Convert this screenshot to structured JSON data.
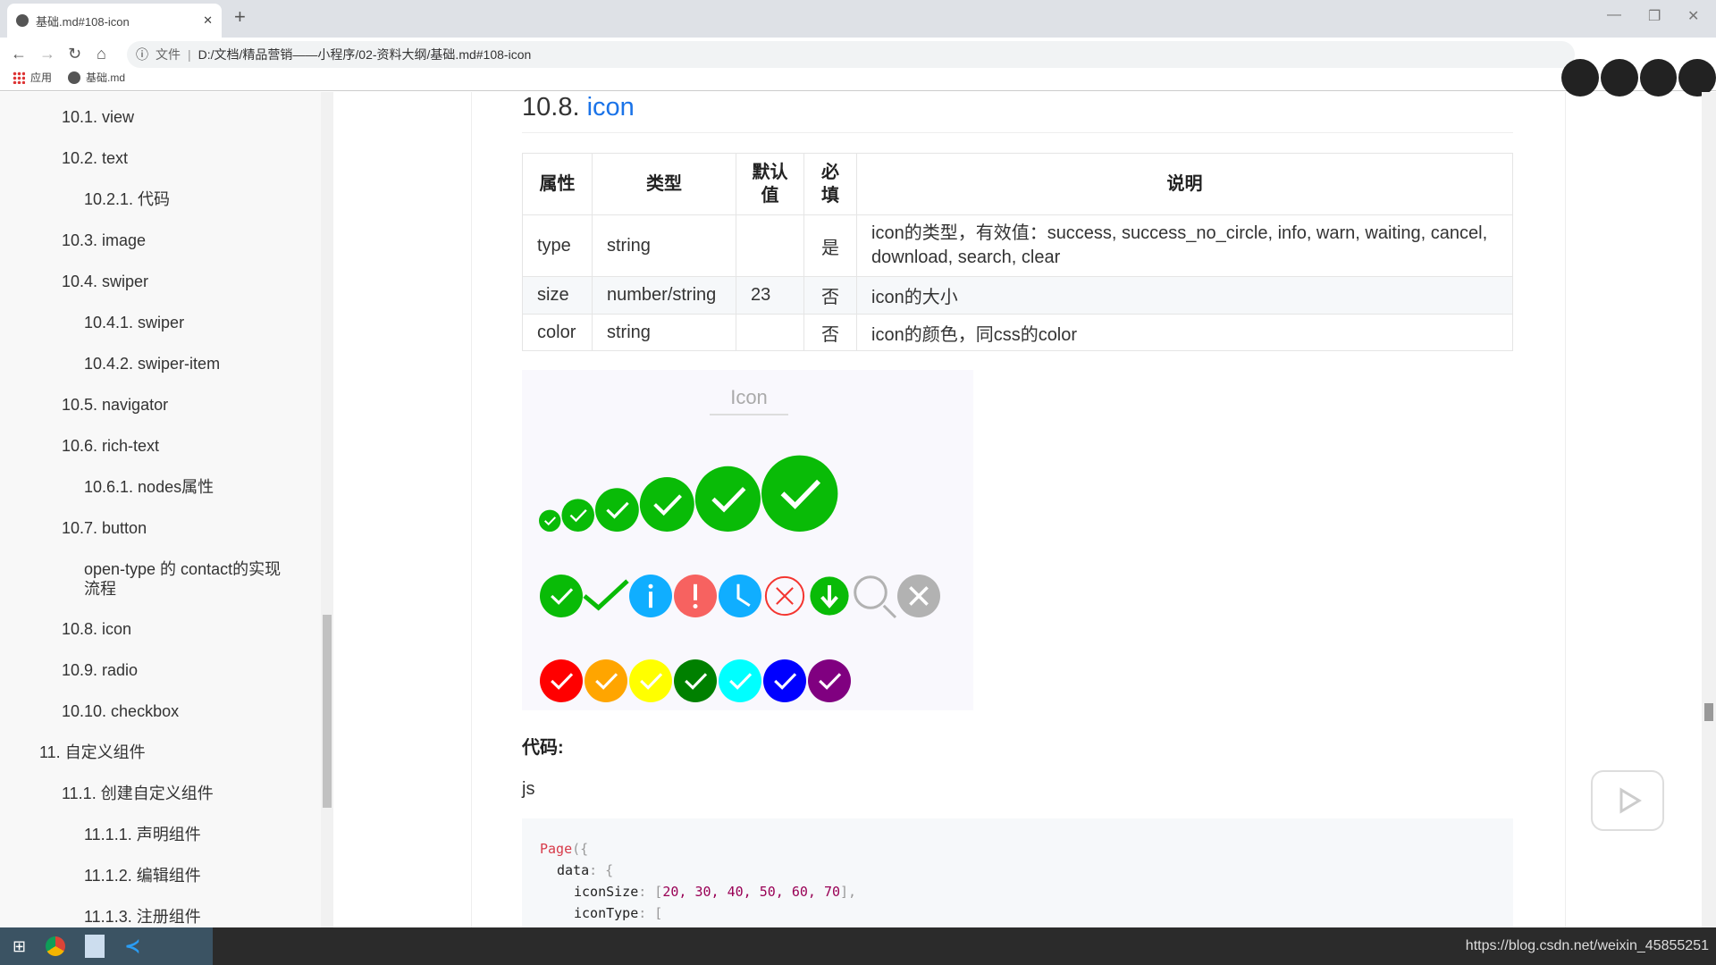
{
  "browser": {
    "tab_title": "基础.md#108-icon",
    "url_label": "文件",
    "url": "D:/文档/精品营销——小程序/02-资料大纲/基础.md#108-icon",
    "bookmarks": [
      {
        "label": "应用"
      },
      {
        "label": "基础.md"
      }
    ]
  },
  "sidebar": {
    "items": [
      {
        "label": "10.1. view",
        "level": 2
      },
      {
        "label": "10.2. text",
        "level": 2
      },
      {
        "label": "10.2.1. 代码",
        "level": 3
      },
      {
        "label": "10.3. image",
        "level": 2
      },
      {
        "label": "10.4. swiper",
        "level": 2
      },
      {
        "label": "10.4.1. swiper",
        "level": 3
      },
      {
        "label": "10.4.2. swiper-item",
        "level": 3
      },
      {
        "label": "10.5. navigator",
        "level": 2
      },
      {
        "label": "10.6. rich-text",
        "level": 2
      },
      {
        "label": "10.6.1. nodes属性",
        "level": 3
      },
      {
        "label": "10.7. button",
        "level": 2
      },
      {
        "label": "open-type 的 contact的实现流程",
        "level": 3
      },
      {
        "label": "10.8. icon",
        "level": 2
      },
      {
        "label": "10.9. radio",
        "level": 2
      },
      {
        "label": "10.10. checkbox",
        "level": 2
      },
      {
        "label": "11. 自定义组件",
        "level": 1
      },
      {
        "label": "11.1. 创建自定义组件",
        "level": 2
      },
      {
        "label": "11.1.1. 声明组件",
        "level": 3
      },
      {
        "label": "11.1.2. 编辑组件",
        "level": 3
      },
      {
        "label": "11.1.3. 注册组件",
        "level": 3
      }
    ]
  },
  "heading": {
    "number": "10.8.",
    "title": "icon"
  },
  "table": {
    "headers": [
      "属性",
      "类型",
      "默认值",
      "必填",
      "说明"
    ],
    "rows": [
      [
        "type",
        "string",
        "",
        "是",
        "icon的类型，有效值：success, success_no_circle, info, warn, waiting, cancel, download, search, clear"
      ],
      [
        "size",
        "number/string",
        "23",
        "否",
        "icon的大小"
      ],
      [
        "color",
        "string",
        "",
        "否",
        "icon的颜色，同css的color"
      ]
    ]
  },
  "preview": {
    "title": "Icon",
    "sizes": [
      20,
      30,
      40,
      50,
      60,
      70
    ],
    "size_color": "#09bb07",
    "types": [
      {
        "type": "success",
        "color": "#09bb07"
      },
      {
        "type": "success_no_circle",
        "color": "#09bb07"
      },
      {
        "type": "info",
        "color": "#10aeff"
      },
      {
        "type": "warn",
        "color": "#f76260"
      },
      {
        "type": "waiting",
        "color": "#10aeff"
      },
      {
        "type": "cancel",
        "color": "#f43530"
      },
      {
        "type": "download",
        "color": "#09bb07"
      },
      {
        "type": "search",
        "color": "#b2b2b2"
      },
      {
        "type": "clear",
        "color": "#b2b2b2"
      }
    ],
    "colors": [
      "red",
      "orange",
      "yellow",
      "green",
      "rgb(0,255,255)",
      "blue",
      "purple"
    ]
  },
  "code_label": "代码:",
  "code_lang": "js",
  "code": {
    "l1a": "Page",
    "l1b": "({",
    "l2a": "data",
    "l2b": ": {",
    "l3a": "iconSize",
    "l3b": ": [",
    "l3c": "20, 30, 40, 50, 60, 70",
    "l3d": "],",
    "l4a": "iconType",
    "l4b": ": ["
  },
  "taskbar": {
    "watermark": "https://blog.csdn.net/weixin_45855251"
  }
}
